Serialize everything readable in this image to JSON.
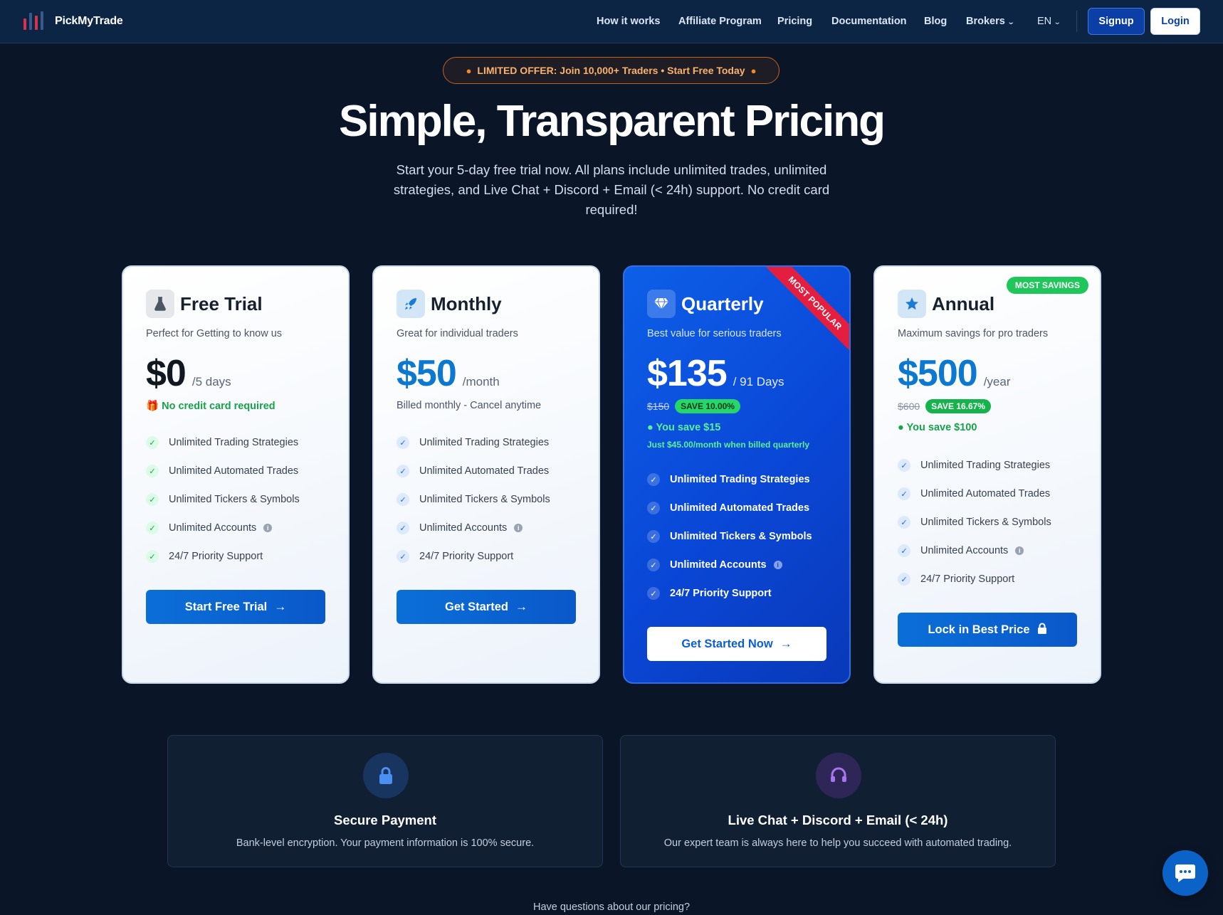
{
  "nav": {
    "brand": "PickMyTrade",
    "links": [
      "How it works",
      "Affiliate Program",
      "Pricing",
      "Documentation",
      "Blog",
      "Brokers",
      "EN"
    ],
    "signup": "Signup",
    "login": "Login"
  },
  "hero": {
    "offer": "LIMITED OFFER: Join 10,000+ Traders • Start Free Today",
    "title": "Simple, Transparent Pricing",
    "subtitle": "Start your 5-day free trial now. All plans include unlimited trades, unlimited strategies, and Live Chat + Discord + Email (< 24h) support. No credit card required!"
  },
  "features": [
    "Unlimited Trading Strategies",
    "Unlimited Automated Trades",
    "Unlimited Tickers & Symbols",
    "Unlimited Accounts",
    "24/7 Priority Support"
  ],
  "plans": [
    {
      "name": "Free Trial",
      "desc": "Perfect for Getting to know us",
      "price": "$0",
      "period": "/5 days",
      "note": "No credit card required",
      "cta": "Start Free Trial"
    },
    {
      "name": "Monthly",
      "desc": "Great for individual traders",
      "price": "$50",
      "period": "/month",
      "note": "Billed monthly - Cancel anytime",
      "cta": "Get Started"
    },
    {
      "name": "Quarterly",
      "desc": "Best value for serious traders",
      "price": "$135",
      "period": "/ 91 Days",
      "original": "$150",
      "save_badge": "SAVE 10.00%",
      "you_save": "You save $15",
      "per_month": "Just $45.00/month when billed quarterly",
      "ribbon": "MOST POPULAR",
      "cta": "Get Started Now"
    },
    {
      "name": "Annual",
      "desc": "Maximum savings for pro traders",
      "price": "$500",
      "period": "/year",
      "original": "$600",
      "save_badge": "SAVE 16.67%",
      "you_save": "You save $100",
      "badge": "MOST SAVINGS",
      "cta": "Lock in Best Price"
    }
  ],
  "info_boxes": [
    {
      "title": "Secure Payment",
      "desc": "Bank-level encryption. Your payment information is 100% secure.",
      "icon": "lock-icon"
    },
    {
      "title": "Live Chat + Discord + Email (< 24h)",
      "desc": "Our expert team is always here to help you succeed with automated trading.",
      "icon": "headset-icon"
    }
  ],
  "footer_question": "Have questions about our pricing?",
  "colors": {
    "accent": "#0c78cf",
    "featured": "#0a47d6",
    "green": "#16a34a",
    "ribbon": "#e41e3f"
  }
}
